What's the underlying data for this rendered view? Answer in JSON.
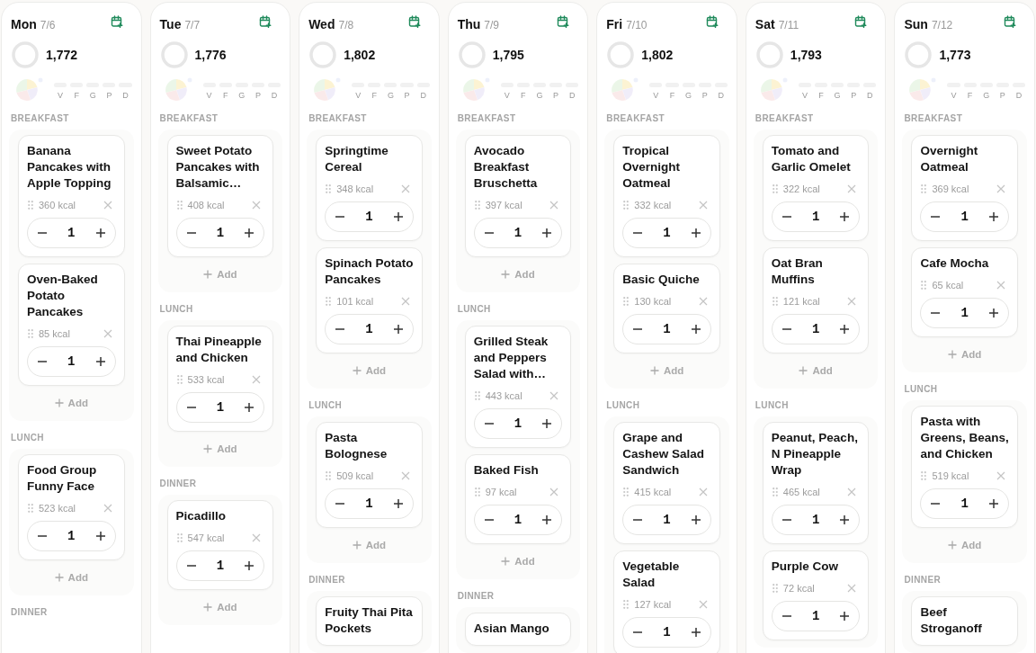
{
  "days": [
    {
      "day": "Mon",
      "date": "7/6",
      "total": "1,772",
      "macros": [
        "V",
        "F",
        "G",
        "P",
        "D"
      ],
      "meals": [
        {
          "label": "BREAKFAST",
          "items": [
            {
              "name": "Banana Pancakes with Apple Topping",
              "kcal": "360 kcal",
              "qty": "1"
            },
            {
              "name": "Oven-Baked Potato Pancakes",
              "kcal": "85 kcal",
              "qty": "1"
            }
          ],
          "add": "Add"
        },
        {
          "label": "LUNCH",
          "items": [
            {
              "name": "Food Group Funny Face",
              "kcal": "523 kcal",
              "qty": "1"
            }
          ],
          "add": "Add"
        },
        {
          "label": "DINNER"
        }
      ]
    },
    {
      "day": "Tue",
      "date": "7/7",
      "total": "1,776",
      "macros": [
        "V",
        "F",
        "G",
        "P",
        "D"
      ],
      "meals": [
        {
          "label": "BREAKFAST",
          "items": [
            {
              "name": "Sweet Potato Pancakes with Balsamic…",
              "kcal": "408 kcal",
              "qty": "1"
            }
          ],
          "add": "Add"
        },
        {
          "label": "LUNCH",
          "items": [
            {
              "name": "Thai Pineapple and Chicken",
              "kcal": "533 kcal",
              "qty": "1"
            }
          ],
          "add": "Add"
        },
        {
          "label": "DINNER",
          "items": [
            {
              "name": "Picadillo",
              "kcal": "547 kcal",
              "qty": "1"
            }
          ],
          "add": "Add"
        }
      ]
    },
    {
      "day": "Wed",
      "date": "7/8",
      "total": "1,802",
      "macros": [
        "V",
        "F",
        "G",
        "P",
        "D"
      ],
      "meals": [
        {
          "label": "BREAKFAST",
          "items": [
            {
              "name": "Springtime Cereal",
              "kcal": "348 kcal",
              "qty": "1"
            },
            {
              "name": "Spinach Potato Pancakes",
              "kcal": "101 kcal",
              "qty": "1"
            }
          ],
          "add": "Add"
        },
        {
          "label": "LUNCH",
          "items": [
            {
              "name": "Pasta Bolognese",
              "kcal": "509 kcal",
              "qty": "1"
            }
          ],
          "add": "Add"
        },
        {
          "label": "DINNER",
          "items": [
            {
              "name": "Fruity Thai Pita Pockets"
            }
          ]
        }
      ]
    },
    {
      "day": "Thu",
      "date": "7/9",
      "total": "1,795",
      "macros": [
        "V",
        "F",
        "G",
        "P",
        "D"
      ],
      "meals": [
        {
          "label": "BREAKFAST",
          "items": [
            {
              "name": "Avocado Breakfast Bruschetta",
              "kcal": "397 kcal",
              "qty": "1"
            }
          ],
          "add": "Add"
        },
        {
          "label": "LUNCH",
          "items": [
            {
              "name": "Grilled Steak and Peppers Salad with…",
              "kcal": "443 kcal",
              "qty": "1"
            },
            {
              "name": "Baked Fish",
              "kcal": "97 kcal",
              "qty": "1"
            }
          ],
          "add": "Add"
        },
        {
          "label": "DINNER",
          "items": [
            {
              "name": "Asian Mango"
            }
          ]
        }
      ]
    },
    {
      "day": "Fri",
      "date": "7/10",
      "total": "1,802",
      "macros": [
        "V",
        "F",
        "G",
        "P",
        "D"
      ],
      "meals": [
        {
          "label": "BREAKFAST",
          "items": [
            {
              "name": "Tropical Overnight Oatmeal",
              "kcal": "332 kcal",
              "qty": "1"
            },
            {
              "name": "Basic Quiche",
              "kcal": "130 kcal",
              "qty": "1"
            }
          ],
          "add": "Add"
        },
        {
          "label": "LUNCH",
          "items": [
            {
              "name": "Grape and Cashew Salad Sandwich",
              "kcal": "415 kcal",
              "qty": "1"
            },
            {
              "name": "Vegetable Salad",
              "kcal": "127 kcal",
              "qty": "1"
            }
          ]
        }
      ]
    },
    {
      "day": "Sat",
      "date": "7/11",
      "total": "1,793",
      "macros": [
        "V",
        "F",
        "G",
        "P",
        "D"
      ],
      "meals": [
        {
          "label": "BREAKFAST",
          "items": [
            {
              "name": "Tomato and Garlic Omelet",
              "kcal": "322 kcal",
              "qty": "1"
            },
            {
              "name": "Oat Bran Muffins",
              "kcal": "121 kcal",
              "qty": "1"
            }
          ],
          "add": "Add"
        },
        {
          "label": "LUNCH",
          "items": [
            {
              "name": "Peanut, Peach, N Pineapple Wrap",
              "kcal": "465 kcal",
              "qty": "1"
            },
            {
              "name": "Purple Cow",
              "kcal": "72 kcal",
              "qty": "1"
            }
          ]
        }
      ]
    },
    {
      "day": "Sun",
      "date": "7/12",
      "total": "1,773",
      "macros": [
        "V",
        "F",
        "G",
        "P",
        "D"
      ],
      "meals": [
        {
          "label": "BREAKFAST",
          "items": [
            {
              "name": "Overnight Oatmeal",
              "kcal": "369 kcal",
              "qty": "1"
            },
            {
              "name": "Cafe Mocha",
              "kcal": "65 kcal",
              "qty": "1"
            }
          ],
          "add": "Add"
        },
        {
          "label": "LUNCH",
          "items": [
            {
              "name": "Pasta with Greens, Beans, and Chicken",
              "kcal": "519 kcal",
              "qty": "1"
            }
          ],
          "add": "Add"
        },
        {
          "label": "DINNER",
          "items": [
            {
              "name": "Beef Stroganoff"
            }
          ]
        }
      ]
    }
  ]
}
